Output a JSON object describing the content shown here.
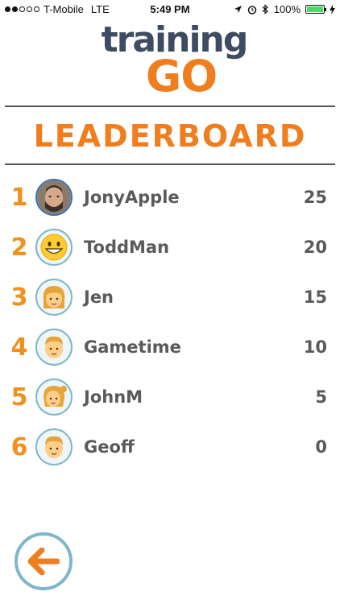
{
  "status_bar": {
    "carrier": "T-Mobile",
    "network": "LTE",
    "time": "5:49 PM",
    "battery": "100%",
    "signal_bars_filled": 2,
    "signal_bars_total": 5,
    "battery_level": 1.0
  },
  "logo": {
    "top": "training",
    "bottom": "GO"
  },
  "title": "LEADERBOARD",
  "colors": {
    "accent_orange": "#f07d1e",
    "logo_navy": "#3d4c63",
    "text_gray": "#5a5a5a",
    "avatar_ring": "#7fb6c9"
  },
  "leaderboard": [
    {
      "rank": "1",
      "name": "JonyApple",
      "score": "25",
      "avatar": "photo-avatar"
    },
    {
      "rank": "2",
      "name": "ToddMan",
      "score": "20",
      "avatar": "grinning-face-icon"
    },
    {
      "rank": "3",
      "name": "Jen",
      "score": "15",
      "avatar": "woman-icon"
    },
    {
      "rank": "4",
      "name": "Gametime",
      "score": "10",
      "avatar": "man-icon"
    },
    {
      "rank": "5",
      "name": "JohnM",
      "score": "5",
      "avatar": "girl-icon"
    },
    {
      "rank": "6",
      "name": "Geoff",
      "score": "0",
      "avatar": "man-icon"
    }
  ],
  "back_button": {
    "icon": "back-arrow-icon"
  }
}
